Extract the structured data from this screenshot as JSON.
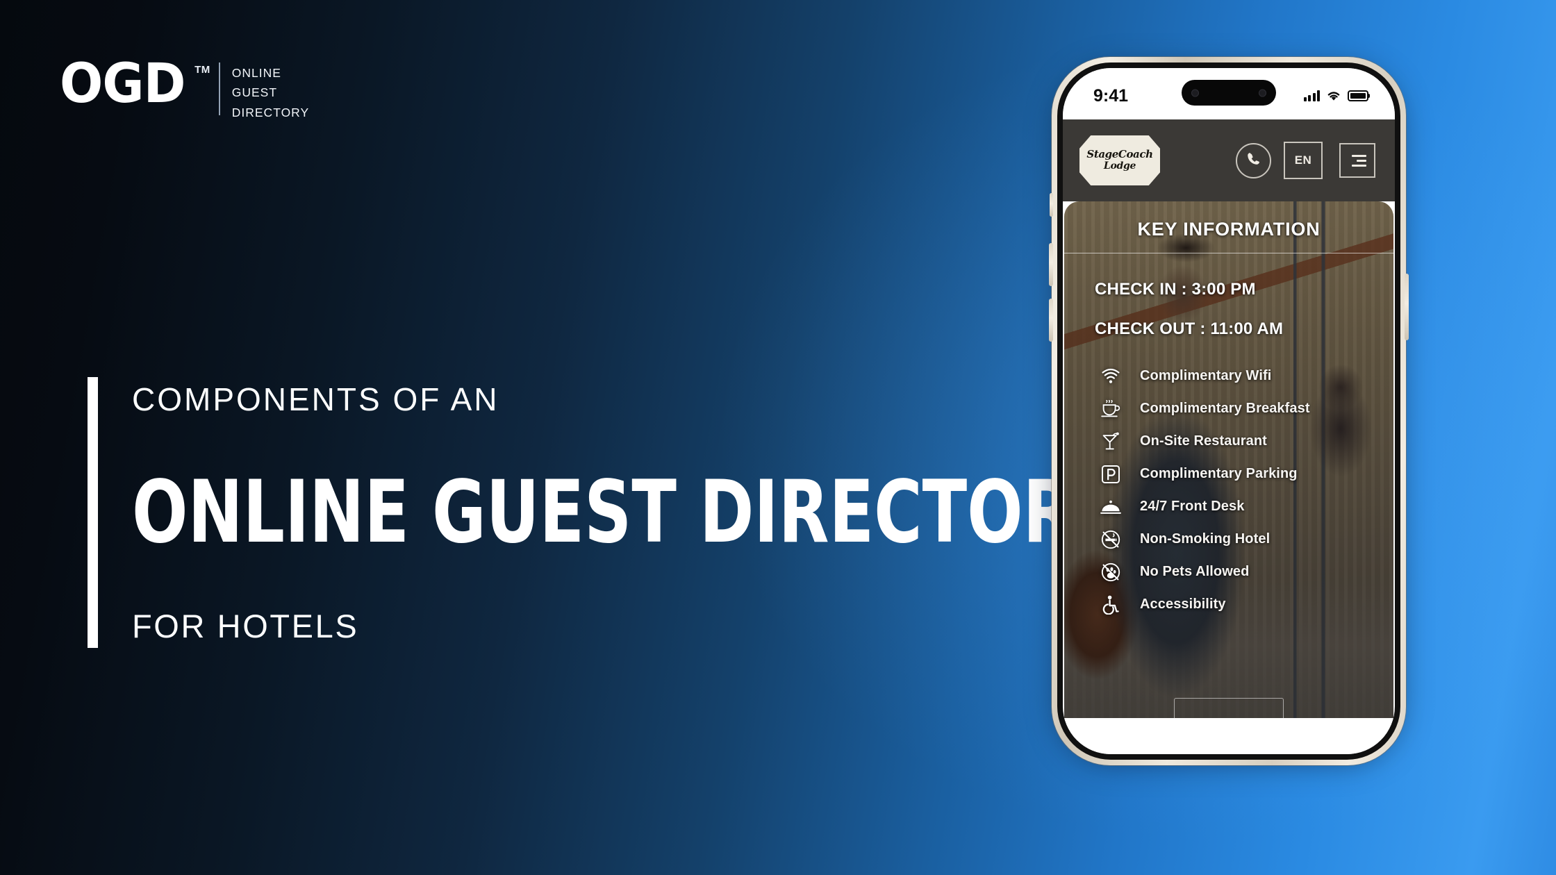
{
  "brand": {
    "mark": "OGD",
    "trademark": "TM",
    "words": [
      "ONLINE",
      "GUEST",
      "DIRECTORY"
    ]
  },
  "headline": {
    "eyebrow": "COMPONENTS OF AN",
    "title": "ONLINE GUEST DIRECTORY",
    "subtitle": "FOR HOTELS"
  },
  "colors": {
    "background_left": "#05090e",
    "background_right": "#2f8ce4",
    "accent_bar": "#ffffff",
    "app_header": "#3b3936",
    "phone_frame": "#efe9dd"
  },
  "phone": {
    "status_bar": {
      "time": "9:41",
      "signal_icon": "signal-bars-icon",
      "wifi_icon": "wifi-icon",
      "battery_icon": "battery-full-icon"
    },
    "app_header": {
      "hotel_logo_line1": "StageCoach",
      "hotel_logo_line2": "Lodge",
      "call_icon": "phone-icon",
      "language_label": "EN",
      "menu_icon": "hamburger-menu-icon"
    },
    "key_information": {
      "title": "KEY INFORMATION",
      "check_in": "CHECK IN : 3:00 PM",
      "check_out": "CHECK OUT : 11:00 AM",
      "amenities": [
        {
          "label": "Complimentary Wifi",
          "icon": "wifi-icon"
        },
        {
          "label": "Complimentary Breakfast",
          "icon": "coffee-cup-icon"
        },
        {
          "label": "On-Site Restaurant",
          "icon": "cocktail-glass-icon"
        },
        {
          "label": "Complimentary Parking",
          "icon": "parking-p-icon"
        },
        {
          "label": "24/7 Front Desk",
          "icon": "service-bell-icon"
        },
        {
          "label": "Non-Smoking Hotel",
          "icon": "no-smoking-icon"
        },
        {
          "label": "No Pets Allowed",
          "icon": "no-pets-icon"
        },
        {
          "label": "Accessibility",
          "icon": "wheelchair-icon"
        }
      ]
    }
  }
}
